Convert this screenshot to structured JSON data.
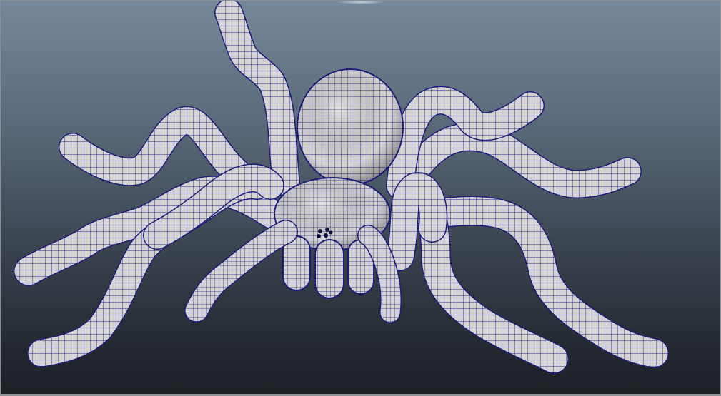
{
  "viewport": {
    "background_top": "#76889a",
    "background_bottom": "#1c2126"
  },
  "model": {
    "name": "spider-mesh",
    "shading": "smooth-shaded-with-wireframe",
    "mesh_fill": "#dcdad8",
    "wire_color": "#1d1d8a"
  }
}
